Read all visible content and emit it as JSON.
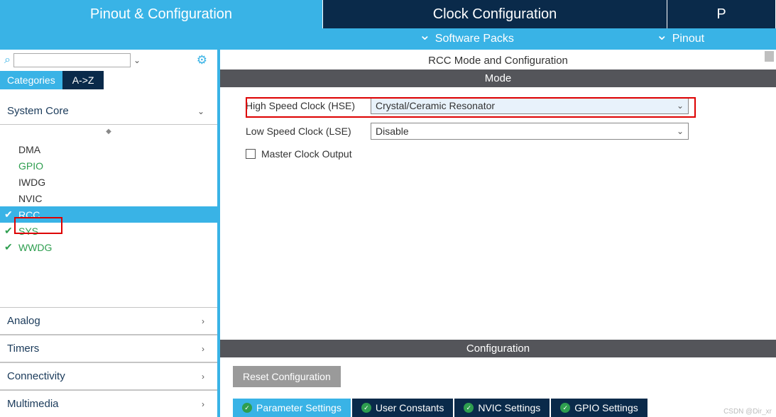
{
  "top_tabs": {
    "pinout": "Pinout & Configuration",
    "clock": "Clock Configuration",
    "third": "P"
  },
  "sub_bar": {
    "software_packs": "Software Packs",
    "pinout": "Pinout"
  },
  "sidebar": {
    "cat_label": "Categories",
    "az_label": "A->Z",
    "sections": {
      "system_core": "System Core",
      "analog": "Analog",
      "timers": "Timers",
      "connectivity": "Connectivity",
      "multimedia": "Multimedia"
    },
    "items": [
      {
        "label": "DMA",
        "green": false,
        "check": false
      },
      {
        "label": "GPIO",
        "green": true,
        "check": false
      },
      {
        "label": "IWDG",
        "green": false,
        "check": false
      },
      {
        "label": "NVIC",
        "green": false,
        "check": false
      },
      {
        "label": "RCC",
        "green": false,
        "check": true,
        "selected": true
      },
      {
        "label": "SYS",
        "green": true,
        "check": true
      },
      {
        "label": "WWDG",
        "green": true,
        "check": true
      }
    ]
  },
  "config": {
    "title": "RCC Mode and Configuration",
    "mode_header": "Mode",
    "hse_label": "High Speed Clock (HSE)",
    "hse_value": "Crystal/Ceramic Resonator",
    "lse_label": "Low Speed Clock (LSE)",
    "lse_value": "Disable",
    "mco_label": "Master Clock Output",
    "config_header": "Configuration",
    "reset_btn": "Reset Configuration",
    "tabs": {
      "param": "Parameter Settings",
      "user": "User Constants",
      "nvic": "NVIC Settings",
      "gpio": "GPIO Settings"
    }
  },
  "watermark": "CSDN @Dir_xr"
}
